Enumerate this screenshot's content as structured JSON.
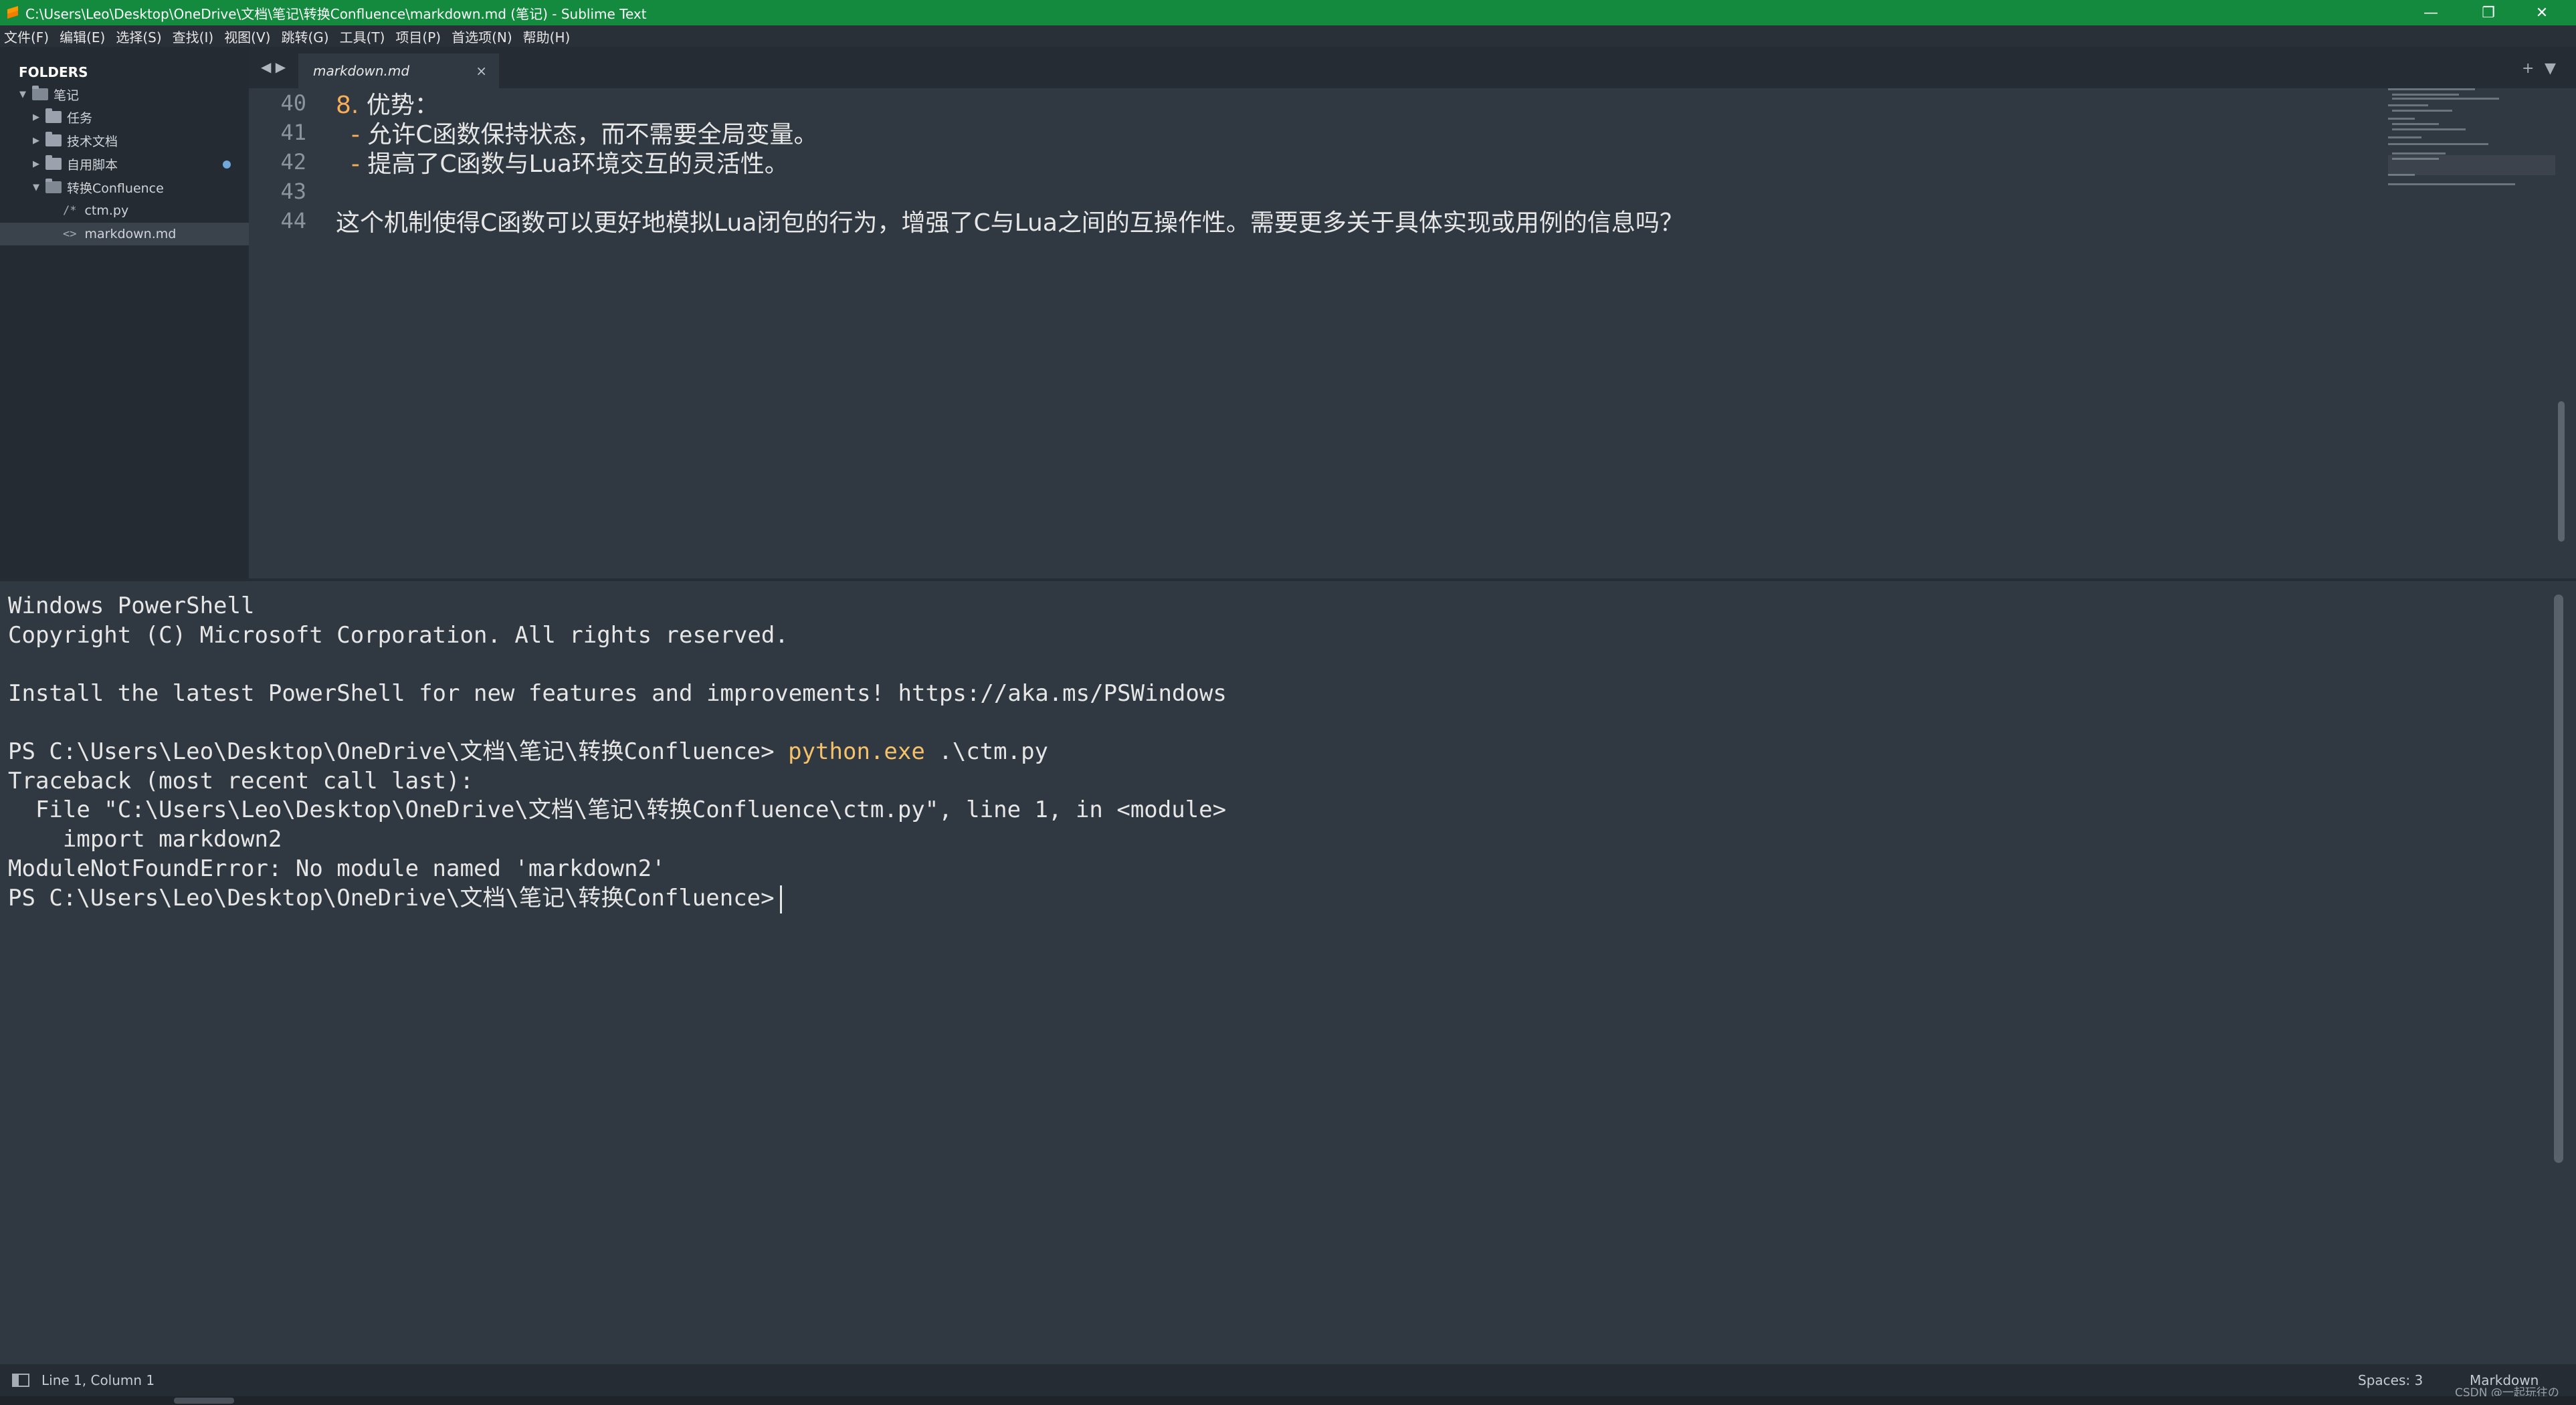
{
  "window": {
    "title": "C:\\Users\\Leo\\Desktop\\OneDrive\\文档\\笔记\\转换Confluence\\markdown.md (笔记) - Sublime Text",
    "controls": {
      "minimize": "—",
      "restore": "❐",
      "close": "✕"
    }
  },
  "menu": {
    "items": [
      "文件(F)",
      "编辑(E)",
      "选择(S)",
      "查找(I)",
      "视图(V)",
      "跳转(G)",
      "工具(T)",
      "项目(P)",
      "首选项(N)",
      "帮助(H)"
    ]
  },
  "sidebar": {
    "header": "FOLDERS",
    "items": [
      {
        "label": "笔记",
        "type": "folder-open"
      },
      {
        "label": "任务",
        "type": "folder"
      },
      {
        "label": "技术文档",
        "type": "folder"
      },
      {
        "label": "自用脚本",
        "type": "folder",
        "dirty": true
      },
      {
        "label": "转换Confluence",
        "type": "folder-open"
      },
      {
        "label": "ctm.py",
        "type": "file",
        "glyph": "/*"
      },
      {
        "label": "markdown.md",
        "type": "file",
        "glyph": "<>",
        "selected": true
      }
    ]
  },
  "tabs": {
    "nav": "◀ ▶",
    "active": {
      "label": "markdown.md",
      "close": "×"
    },
    "new_tab": "+",
    "menu": "▼"
  },
  "editor": {
    "lines": [
      {
        "number": "40",
        "prefix": "8.",
        "text": " 优势："
      },
      {
        "number": "41",
        "prefix": "  -",
        "text": " 允许C函数保持状态，而不需要全局变量。"
      },
      {
        "number": "42",
        "prefix": "  -",
        "text": " 提高了C函数与Lua环境交互的灵活性。"
      },
      {
        "number": "43",
        "prefix": "",
        "text": ""
      },
      {
        "number": "44",
        "prefix": "",
        "text": "这个机制使得C函数可以更好地模拟Lua闭包的行为，增强了C与Lua之间的互操作性。需要更多关于具体实现或用例的信息吗？"
      }
    ]
  },
  "terminal": {
    "header1": "Windows PowerShell",
    "header2": "Copyright (C) Microsoft Corporation. All rights reserved.",
    "install": "Install the latest PowerShell for new features and improvements! https://aka.ms/PSWindows",
    "prompt": "PS C:\\Users\\Leo\\Desktop\\OneDrive\\文档\\笔记\\转换Confluence>",
    "cmd": "python.exe",
    "cmd_arg": " .\\ctm.py",
    "traceback": "Traceback (most recent call last):",
    "file_line": "  File \"C:\\Users\\Leo\\Desktop\\OneDrive\\文档\\笔记\\转换Confluence\\ctm.py\", line 1, in <module>",
    "import_line": "    import markdown2",
    "error": "ModuleNotFoundError: No module named 'markdown2'"
  },
  "status": {
    "position": "Line 1, Column 1",
    "indent": "Spaces: 3",
    "syntax": "Markdown",
    "watermark": "CSDN @一起玩往の"
  }
}
